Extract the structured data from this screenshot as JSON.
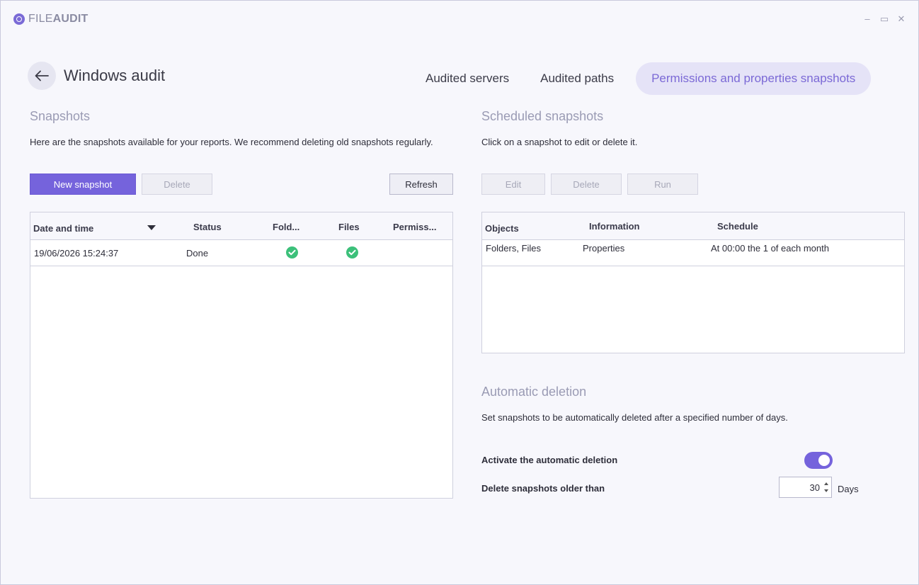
{
  "app": {
    "brand_light": "FILE",
    "brand_bold": "AUDIT",
    "controls": {
      "minimize": "–",
      "maximize": "▭",
      "close": "✕"
    }
  },
  "header": {
    "title": "Windows audit",
    "tabs": [
      {
        "label": "Audited servers"
      },
      {
        "label": "Audited paths"
      },
      {
        "label": "Permissions and properties snapshots"
      }
    ]
  },
  "snapshots": {
    "title": "Snapshots",
    "description": "Here are the snapshots available for your reports. We recommend deleting old snapshots regularly.",
    "buttons": {
      "new": "New snapshot",
      "delete": "Delete",
      "refresh": "Refresh"
    },
    "columns": [
      "Date and time",
      "Status",
      "Fold...",
      "Files",
      "Permiss..."
    ],
    "rows": [
      {
        "date": "19/06/2026 15:24:37",
        "status": "Done",
        "folders": "check-icon",
        "files": "check-icon",
        "permissions": ""
      }
    ]
  },
  "scheduled": {
    "title": "Scheduled snapshots",
    "description": "Click on a snapshot to edit or delete it.",
    "buttons": {
      "edit": "Edit",
      "delete": "Delete",
      "run": "Run"
    },
    "columns": [
      "Objects",
      "Information",
      "Schedule"
    ],
    "rows": [
      {
        "objects": "Folders, Files",
        "information": "Properties",
        "schedule": "At 00:00 the 1 of each month"
      }
    ]
  },
  "auto_delete": {
    "title": "Automatic deletion",
    "description": "Set snapshots to be automatically deleted after a specified number of days.",
    "activate_label": "Activate the automatic deletion",
    "activate_on": true,
    "older_than_label": "Delete snapshots older than",
    "days_value": "30",
    "days_unit": "Days"
  },
  "colors": {
    "accent": "#7563dc",
    "accent_soft": "#e5e3f7",
    "success": "#3cc07a",
    "muted_title": "#9a9bb4"
  }
}
